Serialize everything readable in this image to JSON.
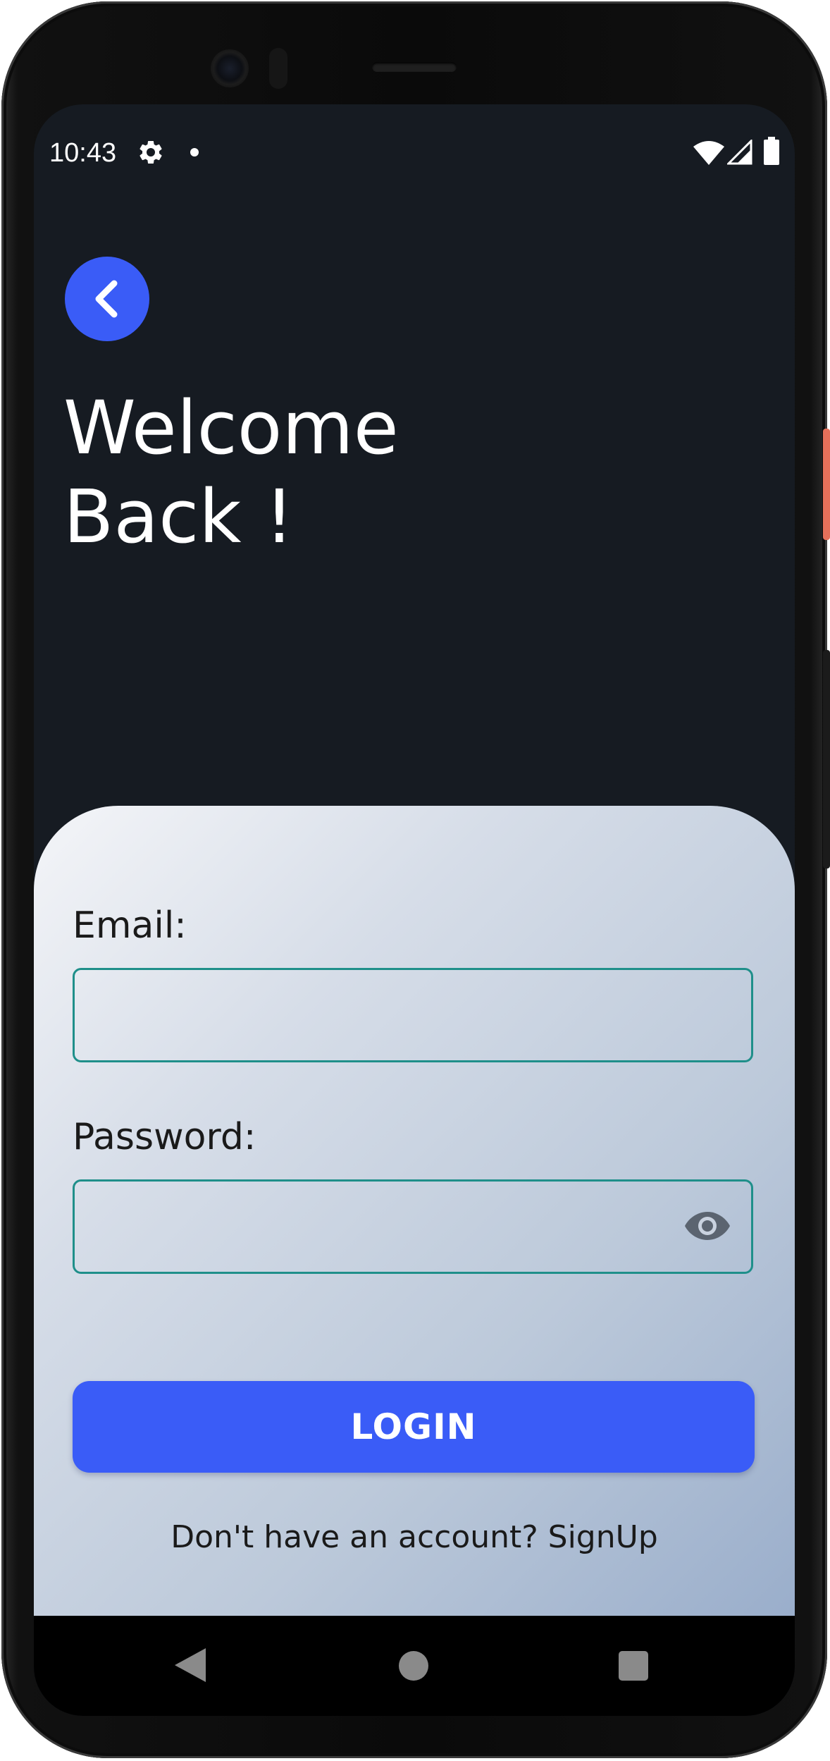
{
  "status_bar": {
    "time": "10:43",
    "icons": [
      "gear-icon",
      "notification-dot",
      "wifi-icon",
      "cell-signal-icon",
      "battery-icon"
    ]
  },
  "header": {
    "back_icon": "chevron-left-icon",
    "title": "Welcome\nBack !"
  },
  "form": {
    "email_label": "Email:",
    "email_value": "",
    "password_label": "Password:",
    "password_value": "",
    "password_toggle_icon": "eye-icon",
    "login_label": "LOGIN",
    "signup_prompt": "Don't have an account? ",
    "signup_link": "SignUp"
  },
  "nav_bar": {
    "icons": [
      "back-triangle-icon",
      "home-circle-icon",
      "recents-square-icon"
    ]
  },
  "colors": {
    "screen_background": "#161b22",
    "accent": "#3a5cf7",
    "field_border": "#1f8f8a",
    "card_gradient_start": "#f4f5f8",
    "card_gradient_end": "#9aaecb"
  }
}
